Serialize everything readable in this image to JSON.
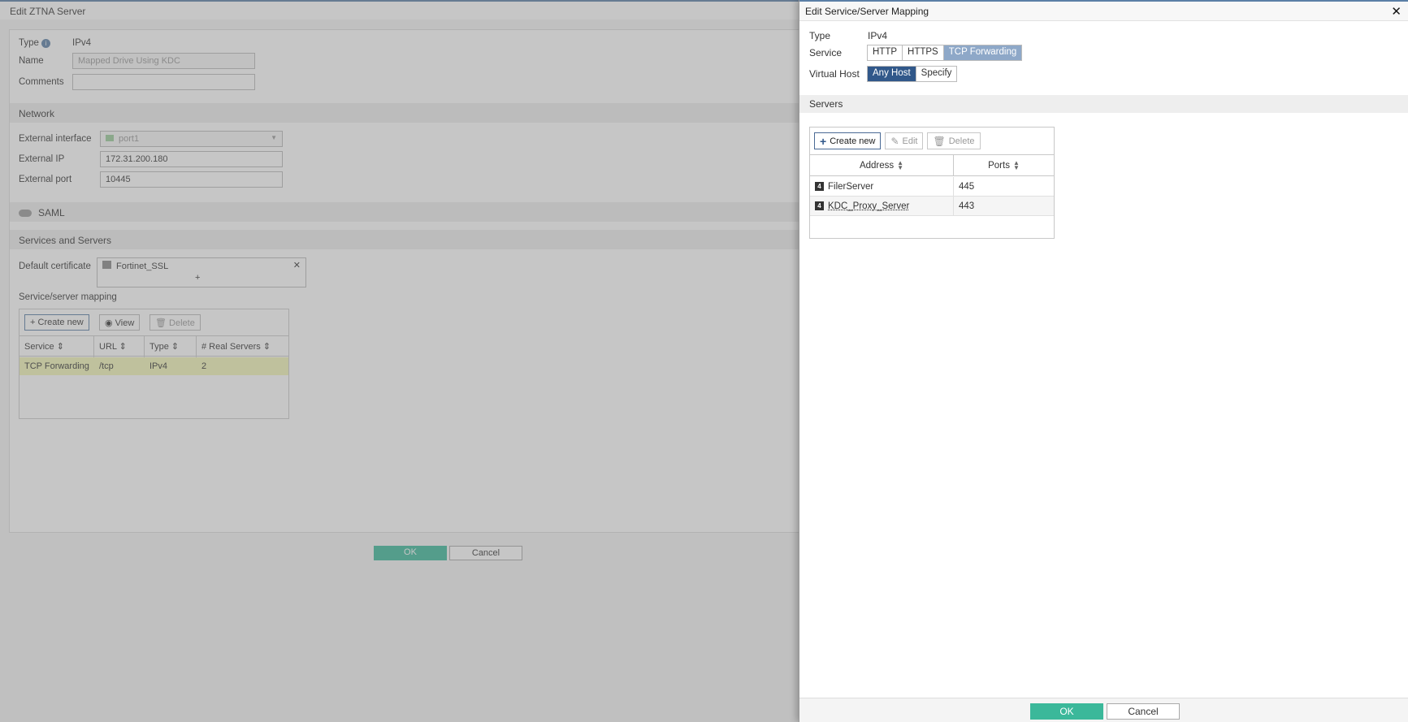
{
  "background": {
    "window_title": "Edit ZTNA Server",
    "type_label": "Type",
    "type_value": "IPv4",
    "name_label": "Name",
    "name_value": "Mapped Drive Using KDC",
    "comments_label": "Comments",
    "network_section": "Network",
    "ext_interface_label": "External interface",
    "ext_interface_value": "port1",
    "ext_ip_label": "External IP",
    "ext_ip_value": "172.31.200.180",
    "ext_port_label": "External port",
    "ext_port_value": "10445",
    "saml_label": "SAML",
    "services_section": "Services and Servers",
    "default_cert_label": "Default certificate",
    "default_cert_value": "Fortinet_SSL",
    "add_symbol": "+",
    "mapping_label": "Service/server mapping",
    "toolbar": {
      "create_new": "Create new",
      "view": "View",
      "delete": "Delete"
    },
    "columns": [
      "Service",
      "URL",
      "Type",
      "# Real Servers"
    ],
    "rows": [
      {
        "service": "TCP Forwarding",
        "url": "/tcp",
        "type": "IPv4",
        "real_servers": "2"
      }
    ],
    "ok": "OK",
    "cancel": "Cancel"
  },
  "dialog": {
    "title": "Edit Service/Server Mapping",
    "close_glyph": "✕",
    "type_label": "Type",
    "type_value": "IPv4",
    "service_label": "Service",
    "service_options": [
      "HTTP",
      "HTTPS",
      "TCP Forwarding"
    ],
    "service_selected": "TCP Forwarding",
    "virtual_host_label": "Virtual Host",
    "virtual_host_options": [
      "Any Host",
      "Specify"
    ],
    "virtual_host_selected": "Any Host",
    "servers_section": "Servers",
    "toolbar": {
      "create_new": "Create new",
      "edit": "Edit",
      "delete": "Delete"
    },
    "columns": {
      "address": "Address",
      "ports": "Ports"
    },
    "rows": [
      {
        "address": "FilerServer",
        "port": "445",
        "icon": "address-object-icon"
      },
      {
        "address": "KDC_Proxy_Server",
        "port": "443",
        "icon": "address-object-icon"
      }
    ],
    "ok": "OK",
    "cancel": "Cancel"
  },
  "colors": {
    "accent_dark": "#31588a",
    "accent_light": "#8ea8c8",
    "ok_green": "#3bb89a",
    "row_highlight": "#f3f6b8"
  }
}
